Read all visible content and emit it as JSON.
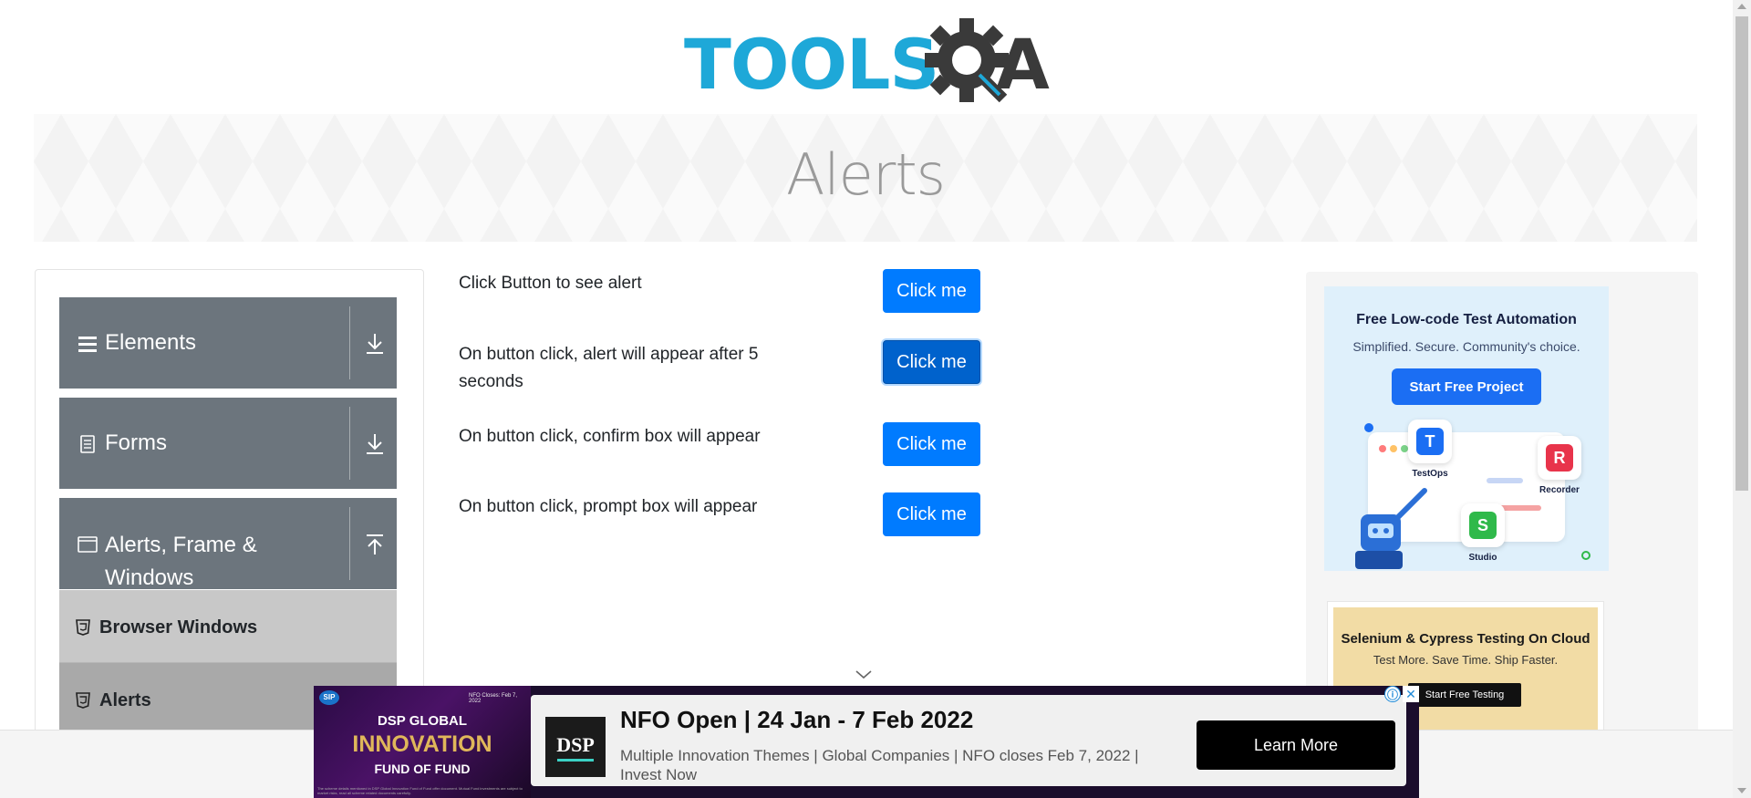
{
  "logo": {
    "text_left": "TOOLS",
    "text_right": "A",
    "brand_blue": "#1ea8d8",
    "brand_dark": "#3a3a3a"
  },
  "header": {
    "title": "Alerts"
  },
  "sidebar": {
    "groups": [
      {
        "label": "Elements",
        "icon": "hamburger-icon",
        "state": "collapsed",
        "arrow": "download-arrow-icon"
      },
      {
        "label": "Forms",
        "icon": "document-icon",
        "state": "collapsed",
        "arrow": "download-arrow-icon"
      },
      {
        "label": "Alerts, Frame & Windows",
        "icon": "window-icon",
        "state": "expanded",
        "arrow": "upload-arrow-icon"
      }
    ],
    "subitems": [
      {
        "label": "Browser Windows",
        "icon": "html5-icon",
        "active": false
      },
      {
        "label": "Alerts",
        "icon": "html5-icon",
        "active": true
      }
    ],
    "group_bg": "#6c757d"
  },
  "main": {
    "rows": [
      {
        "label": "Click Button to see alert",
        "button": "Click me"
      },
      {
        "label": "On button click, alert will appear after 5 seconds",
        "button": "Click me"
      },
      {
        "label": "On button click, confirm box will appear",
        "button": "Click me"
      },
      {
        "label": "On button click, prompt box will appear",
        "button": "Click me"
      }
    ],
    "button_color": "#007bff"
  },
  "right_ads": {
    "ad1": {
      "title": "Free Low-code Test Automation",
      "subtitle": "Simplified. Secure. Community's choice.",
      "cta": "Start Free Project",
      "tiles": [
        {
          "letter": "T",
          "caption": "TestOps"
        },
        {
          "letter": "R",
          "caption": "Recorder"
        },
        {
          "letter": "S",
          "caption": "Studio"
        }
      ]
    },
    "ad2": {
      "title": "Selenium & Cypress Testing On Cloud",
      "subtitle": "Test More. Save Time. Ship Faster.",
      "cta": "Start Free Testing"
    }
  },
  "bottom_ad": {
    "brand_badge": "SIP",
    "date_badge": "NFO Closes: Feb 7, 2022",
    "left_line1": "DSP GLOBAL",
    "left_line2": "INNOVATION",
    "left_line3": "FUND OF FUND",
    "fine_print": "The scheme details mentioned in DSP Global Innovation Fund of Fund offer document. Mutual Fund investments are subject to market risks, read all scheme related documents carefully.",
    "logo_text": "DSP",
    "headline": "NFO Open | 24 Jan - 7 Feb 2022",
    "description": "Multiple Innovation Themes | Global Companies | NFO closes Feb 7, 2022 | Invest Now",
    "cta": "Learn More",
    "info_icon": "ⓘ",
    "close_icon": "✕"
  }
}
